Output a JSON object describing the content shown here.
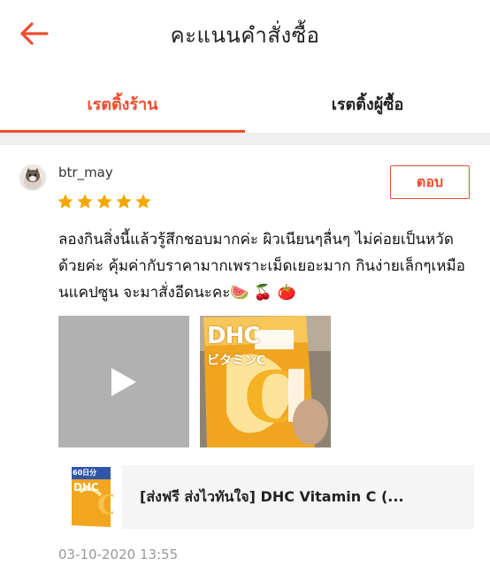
{
  "header": {
    "title": "คะแนนคำสั่งซื้อ",
    "back_icon": "arrow-left-icon"
  },
  "tabs": [
    {
      "label": "เรตติ้งร้าน",
      "active": true
    },
    {
      "label": "เรตติ้งผู้ซื้อ",
      "active": false
    }
  ],
  "review": {
    "username": "btr_may",
    "rating": 5,
    "reply_label": "ตอบ",
    "text": "ลองกินสิ่งนี้แล้วรู้สึกชอบมากค่ะ ผิวเนียนๆลื่นๆ ไม่ค่อยเป็นหวัดด้วยค่ะ คุ้มค่ากับราคามากเพราะเม็ดเยอะมาก กินง่ายเล็กๆเหมือนแคปซูน จะมาสั่งอีดนะคะ🍉 🍒 🍅",
    "media": [
      {
        "type": "video",
        "icon": "play-icon"
      },
      {
        "type": "photo",
        "brand_text": "DHC",
        "label_text": "ビタミンC"
      }
    ],
    "product": {
      "name": "[ส่งฟรี ส่งไวทันใจ] DHC Vitamin C (...",
      "thumb_brand": "DHC",
      "thumb_days": "60日分"
    },
    "timestamp": "03-10-2020 13:55"
  },
  "colors": {
    "accent": "#ee4d2d",
    "star": "#f6a700",
    "divider": "#efefef"
  }
}
